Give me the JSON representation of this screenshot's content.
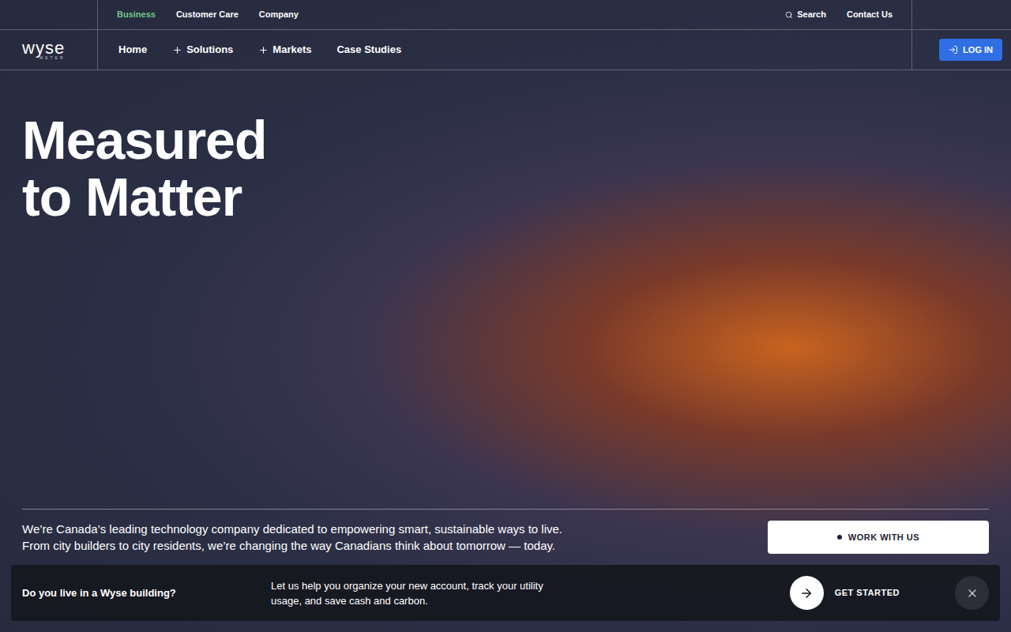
{
  "logo": {
    "name": "wyse",
    "sub": "METER"
  },
  "top_nav": {
    "items": [
      {
        "label": "Business",
        "selected": true
      },
      {
        "label": "Customer Care",
        "selected": false
      },
      {
        "label": "Company",
        "selected": false
      }
    ],
    "search": "Search",
    "contact": "Contact Us"
  },
  "main_nav": [
    {
      "label": "Home",
      "expandable": false
    },
    {
      "label": "Solutions",
      "expandable": true
    },
    {
      "label": "Markets",
      "expandable": true
    },
    {
      "label": "Case Studies",
      "expandable": false
    }
  ],
  "login": "LOG IN",
  "hero": {
    "headline": [
      "Measured",
      "to Matter"
    ],
    "description": [
      "We’re Canada’s leading technology company dedicated to empowering smart, sustainable ways to live.",
      "From city builders to city residents, we’re changing the way Canadians think about tomorrow — today."
    ],
    "cta": "WORK WITH US"
  },
  "banner": {
    "question": "Do you live in a Wyse building?",
    "text": "Let us help you organize your new account, track your utility usage, and save cash and carbon.",
    "cta": "GET STARTED"
  }
}
